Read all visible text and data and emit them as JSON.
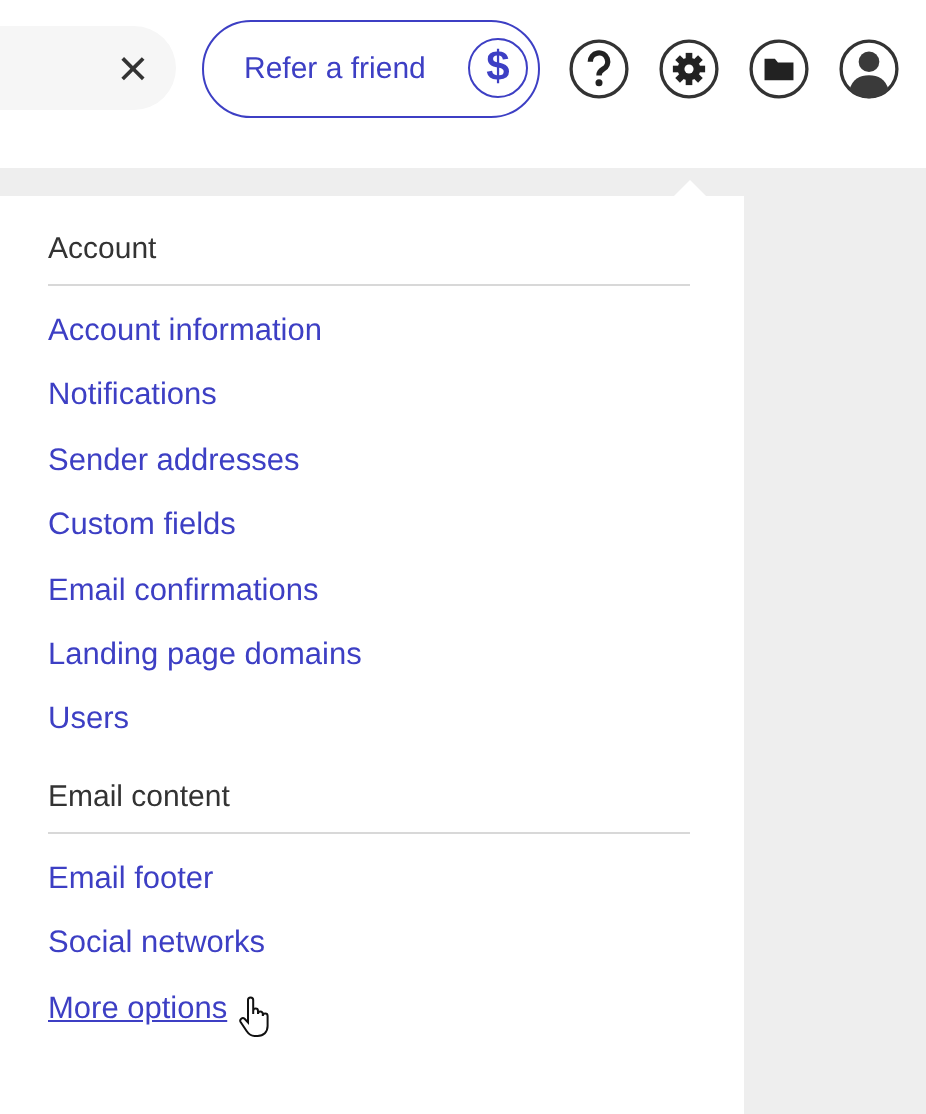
{
  "top_bar": {
    "search": {
      "clear": "×"
    },
    "refer_button": {
      "label": "Refer a friend",
      "badge": "$"
    }
  },
  "menu": {
    "sections": [
      {
        "heading": "Account",
        "links": [
          {
            "label": "Account information",
            "hovered": false
          },
          {
            "label": "Notifications",
            "hovered": false
          },
          {
            "label": "Sender addresses",
            "hovered": false
          },
          {
            "label": "Custom fields",
            "hovered": false
          },
          {
            "label": "Email confirmations",
            "hovered": false
          },
          {
            "label": "Landing page domains",
            "hovered": false
          },
          {
            "label": "Users",
            "hovered": false
          }
        ]
      },
      {
        "heading": "Email content",
        "links": [
          {
            "label": "Email footer",
            "hovered": false
          },
          {
            "label": "Social networks",
            "hovered": false
          },
          {
            "label": "More options",
            "hovered": true
          }
        ]
      }
    ]
  }
}
